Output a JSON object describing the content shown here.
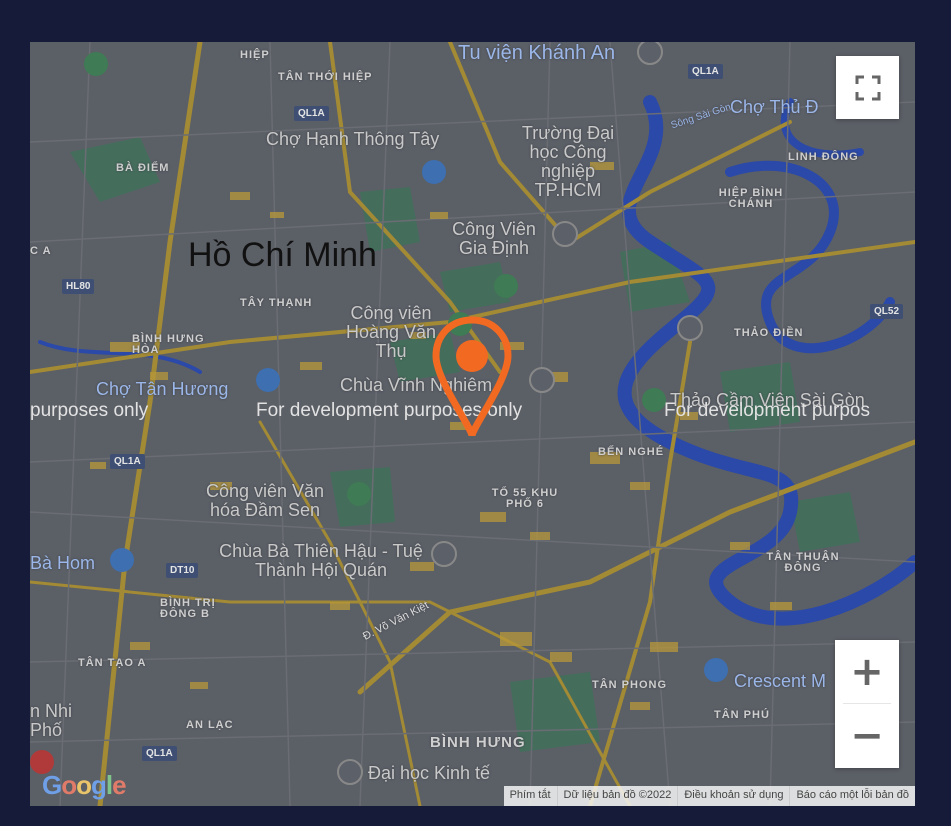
{
  "map": {
    "city_label": "Hồ Chí Minh",
    "watermark": [
      "purposes only",
      "For development purposes only",
      "For development purpos"
    ],
    "district_labels": [
      "HIỆP",
      "TÂN THỚI HIỆP",
      "BÀ ĐIỂM",
      "TÂY THẠNH",
      "BÌNH HƯNG HÒA",
      "BẾN NGHÉ",
      "TỔ 55 KHU PHỐ 6",
      "BÌNH TRỊ ĐÔNG B",
      "TÂN TẠO A",
      "AN LẠC",
      "BÌNH HƯNG",
      "TÂN PHONG",
      "TÂN PHÚ",
      "TÂN THUẬN ĐÔNG",
      "LINH ĐÔNG",
      "HIỆP BÌNH CHÁNH",
      "THẢO ĐIỀN",
      "C A"
    ],
    "poi_labels": [
      "Tu viện Khánh An",
      "Chợ Hạnh Thông Tây",
      "Trường Đại học Công nghiệp TP.HCM",
      "Chợ Thủ Đ",
      "Công Viên Gia Định",
      "Công viên Hoàng Văn Thụ",
      "Chùa Vĩnh Nghiêm",
      "Chợ Tân Hương",
      "Thảo Cầm Viên Sài Gòn",
      "Công viên Văn hóa Đầm Sen",
      "Chùa Bà Thiên Hậu - Tuệ Thành Hội Quán",
      "Bà Hom",
      "Crescent M",
      "Đại học Kinh tế",
      "n Nhi Phố"
    ],
    "river_label": "Sông Sài Gòn",
    "road_label": "Đ. Võ Văn Kiệt",
    "route_shields": [
      "QL1A",
      "QL1A",
      "QL1A",
      "QL1A",
      "HL80",
      "DT10",
      "QL52"
    ],
    "controls": {
      "fullscreen_icon": "fullscreen-icon",
      "zoom_in": "+",
      "zoom_out": "−"
    },
    "attribution": [
      "Phím tắt",
      "Dữ liệu bản đồ ©2022",
      "Điều khoản sử dụng",
      "Báo cáo một lỗi bản đồ"
    ],
    "logo_text": "Google",
    "marker_color": "#f26a21",
    "colors": {
      "frame": "#161b3a",
      "land": "#5b5f66",
      "water": "#2b49a8",
      "park": "#41705a",
      "road_major": "#a38a34"
    }
  }
}
